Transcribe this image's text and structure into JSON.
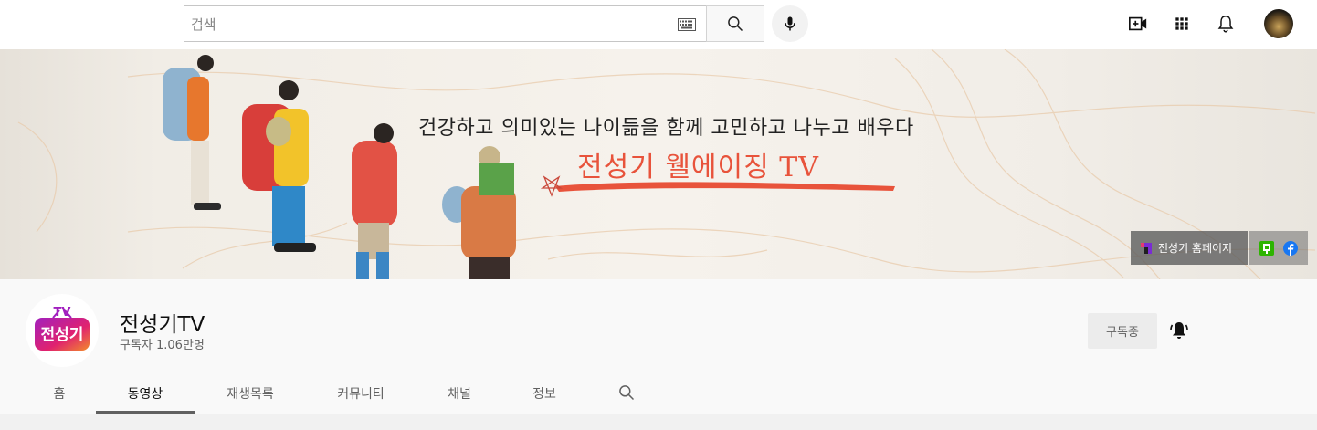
{
  "masthead": {
    "search_placeholder": "검색",
    "icons": [
      "keyboard-icon",
      "search-icon",
      "mic-icon",
      "create-video-icon",
      "apps-grid-icon",
      "notifications-bell-icon"
    ]
  },
  "banner": {
    "tagline": "건강하고 의미있는 나이듦을 함께 고민하고 나누고 배우다",
    "title": "전성기 웰에이징 TV",
    "homepage_link": "전성기 홈페이지",
    "accent_color": "#e8533b"
  },
  "channel": {
    "name": "전성기TV",
    "subscribers": "구독자 1.06만명",
    "avatar_text_top": "TV",
    "avatar_text_main": "전성기",
    "subscribe_label": "구독중"
  },
  "tabs": [
    {
      "label": "홈"
    },
    {
      "label": "동영상",
      "active": true
    },
    {
      "label": "재생목록"
    },
    {
      "label": "커뮤니티"
    },
    {
      "label": "채널"
    },
    {
      "label": "정보"
    }
  ]
}
